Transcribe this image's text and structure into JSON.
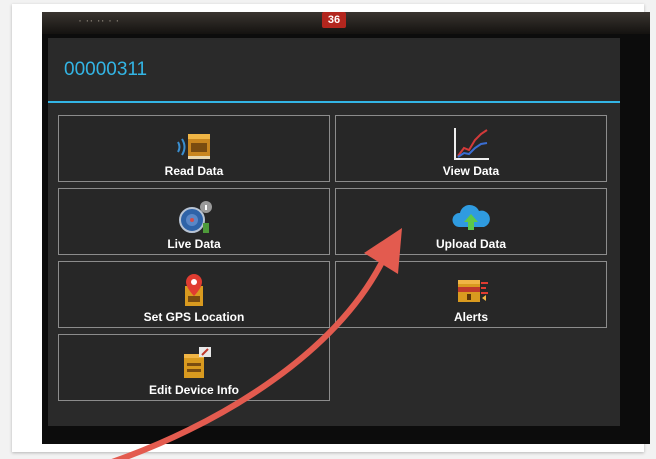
{
  "statusbar": {
    "faded_text": "· ·· ·· · ·",
    "badge": "36"
  },
  "dialog": {
    "title": "00000311"
  },
  "menu": {
    "read_data": "Read Data",
    "view_data": "View Data",
    "live_data": "Live Data",
    "upload_data": "Upload Data",
    "set_gps": "Set GPS Location",
    "alerts": "Alerts",
    "edit_device_info": "Edit Device Info"
  },
  "icons": {
    "read_data": "device-wireless-icon",
    "view_data": "line-chart-icon",
    "live_data": "live-gauge-icon",
    "upload_data": "cloud-upload-icon",
    "set_gps": "map-pin-icon",
    "alerts": "alert-icon",
    "edit_device_info": "edit-device-icon"
  },
  "colors": {
    "accent": "#33b5e5",
    "annotation_arrow": "#e35b4f",
    "badge": "#b3261e"
  }
}
